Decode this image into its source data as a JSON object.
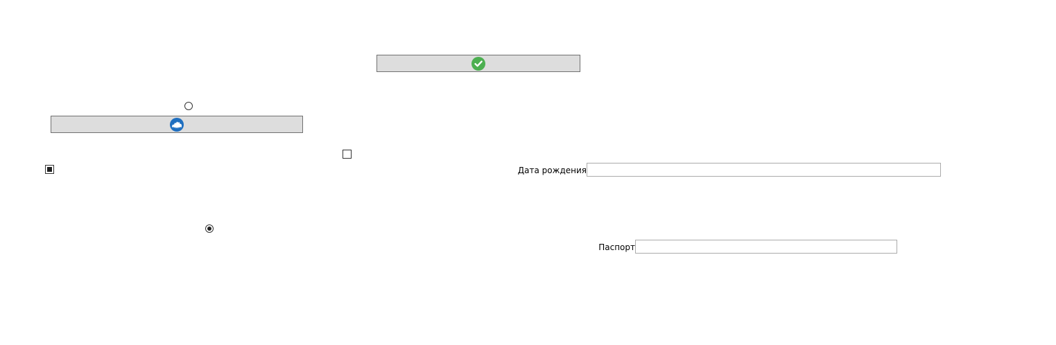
{
  "buttons": {
    "confirm": {
      "icon": "check-circle-icon",
      "icon_color": "#4caf50"
    },
    "wave": {
      "icon": "wave-badge-icon",
      "icon_color": "#1f6fc0"
    }
  },
  "radios": [
    {
      "checked": false
    },
    {
      "checked": true
    }
  ],
  "checkboxes": [
    {
      "checked": false
    },
    {
      "checked": true
    }
  ],
  "form": {
    "birth_date_label": "Дата рождения",
    "birth_date_value": "",
    "passport_label": "Паспорт",
    "passport_value": ""
  }
}
